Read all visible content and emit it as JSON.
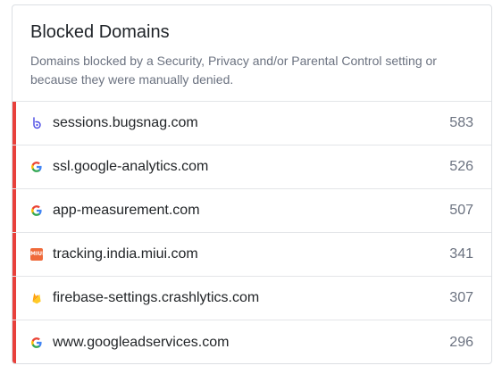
{
  "card": {
    "title": "Blocked Domains",
    "subtitle": "Domains blocked by a Security, Privacy and/or Parental Control setting or because they were manually denied.",
    "accent_color": "#e8403b"
  },
  "domains": [
    {
      "domain": "sessions.bugsnag.com",
      "count": "583",
      "icon": "bugsnag-icon"
    },
    {
      "domain": "ssl.google-analytics.com",
      "count": "526",
      "icon": "google-icon"
    },
    {
      "domain": "app-measurement.com",
      "count": "507",
      "icon": "google-icon"
    },
    {
      "domain": "tracking.india.miui.com",
      "count": "341",
      "icon": "miui-icon",
      "icon_text": "MIUI"
    },
    {
      "domain": "firebase-settings.crashlytics.com",
      "count": "307",
      "icon": "firebase-icon"
    },
    {
      "domain": "www.googleadservices.com",
      "count": "296",
      "icon": "google-icon"
    }
  ]
}
